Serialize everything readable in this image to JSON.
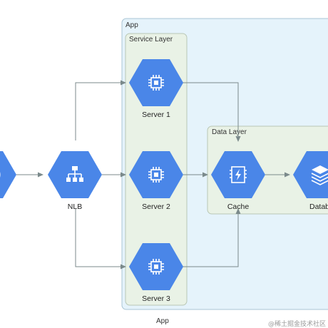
{
  "clusters": {
    "app": {
      "label": "App"
    },
    "service_layer": {
      "label": "Service Layer"
    },
    "data_layer": {
      "label": "Data Layer"
    }
  },
  "nodes": {
    "client": {
      "label": "",
      "icon": "globe-icon"
    },
    "nlb": {
      "label": "NLB",
      "icon": "load-balancer-icon"
    },
    "server1": {
      "label": "Server 1",
      "icon": "compute-chip-icon"
    },
    "server2": {
      "label": "Server 2",
      "icon": "compute-chip-icon"
    },
    "server3": {
      "label": "Server 3",
      "icon": "compute-chip-icon"
    },
    "cache": {
      "label": "Cache",
      "icon": "memorystore-bolt-icon"
    },
    "database": {
      "label": "Databa",
      "icon": "database-stack-icon"
    }
  },
  "caption": "App",
  "watermark": "@稀土掘金技术社区",
  "colors": {
    "node": "#4a86e8",
    "app_cluster_bg": "#e5f3fb",
    "layer_cluster_bg": "#e9f2e6",
    "edge": "#7b8a8b"
  }
}
